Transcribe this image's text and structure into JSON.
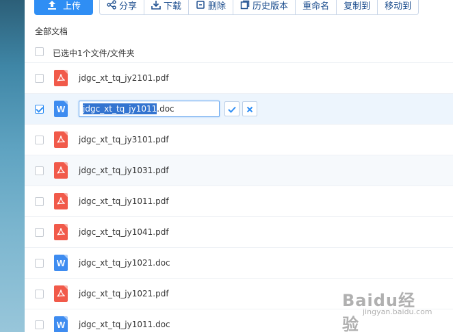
{
  "toolbar": {
    "upload_label": "上传",
    "tools": [
      {
        "icon": "share-icon",
        "label": "分享"
      },
      {
        "icon": "download-icon",
        "label": "下载"
      },
      {
        "icon": "delete-icon",
        "label": "删除"
      },
      {
        "icon": "history-icon",
        "label": "历史版本"
      },
      {
        "icon": "",
        "label": "重命名"
      },
      {
        "icon": "",
        "label": "复制到"
      },
      {
        "icon": "",
        "label": "移动到"
      }
    ]
  },
  "breadcrumb": "全部文档",
  "selection_summary": "已选中1个文件/文件夹",
  "files": [
    {
      "type": "pdf",
      "name": "jdgc_xt_tq_jy2101.pdf",
      "checked": false
    },
    {
      "type": "doc",
      "name": "jdgc_xt_tq_jy1011.doc",
      "checked": true,
      "renaming": true,
      "rename_selected": "jdgc_xt_tq_jy1011",
      "rename_rest": ".doc"
    },
    {
      "type": "pdf",
      "name": "jdgc_xt_tq_jy3101.pdf",
      "checked": false
    },
    {
      "type": "pdf",
      "name": "jdgc_xt_tq_jy1031.pdf",
      "checked": false
    },
    {
      "type": "pdf",
      "name": "jdgc_xt_tq_jy1011.pdf",
      "checked": false
    },
    {
      "type": "pdf",
      "name": "jdgc_xt_tq_jy1041.pdf",
      "checked": false
    },
    {
      "type": "doc",
      "name": "jdgc_xt_tq_jy1021.doc",
      "checked": false
    },
    {
      "type": "pdf",
      "name": "jdgc_xt_tq_jy1021.pdf",
      "checked": false
    },
    {
      "type": "doc",
      "name": "jdgc_xt_tq_jy1011.doc",
      "checked": false
    }
  ],
  "watermark": {
    "main": "Baidu经验",
    "sub": "jingyan.baidu.com"
  },
  "colors": {
    "accent": "#2f8ef4",
    "pdf": "#f15a4a",
    "doc": "#3e8cf0",
    "selection": "#3374d0"
  }
}
